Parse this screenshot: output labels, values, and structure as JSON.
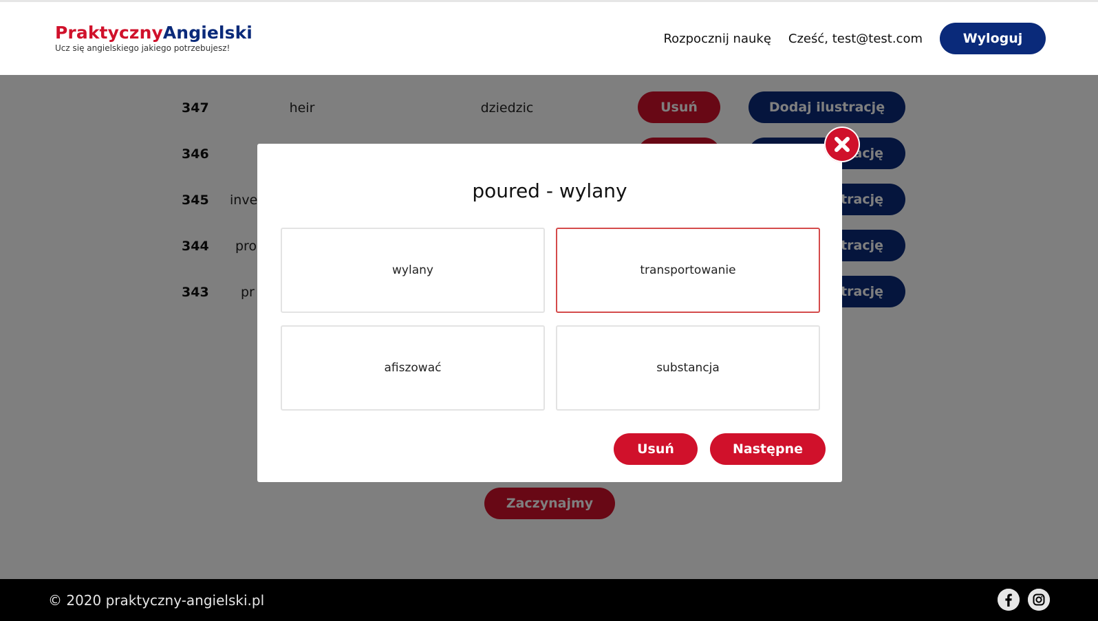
{
  "header": {
    "logo_part1": "Praktyczny",
    "logo_part2": "Angielski",
    "tagline": "Ucz się angielskiego jakiego potrzebujesz!",
    "nav_start": "Rozpocznij naukę",
    "greeting": "Cześć, test@test.com",
    "logout_label": "Wyloguj"
  },
  "rows": [
    {
      "num": "347",
      "en": "heir",
      "pl": "dziedzic",
      "delete_label": "Usuń",
      "illustration_label": "Dodaj ilustrację"
    },
    {
      "num": "346",
      "en": "",
      "pl": "",
      "delete_label": "",
      "illustration_label": "ację"
    },
    {
      "num": "345",
      "en": "inve",
      "pl": "",
      "delete_label": "",
      "illustration_label": "trację"
    },
    {
      "num": "344",
      "en": "pro",
      "pl": "",
      "delete_label": "",
      "illustration_label": "trację"
    },
    {
      "num": "343",
      "en": "pr",
      "pl": "",
      "delete_label": "",
      "illustration_label": "trację"
    }
  ],
  "start_label": "Zaczynajmy",
  "modal": {
    "title": "poured - wylany",
    "options": [
      "wylany",
      "transportowanie",
      "afiszować",
      "substancja"
    ],
    "selected_index": 1,
    "delete_label": "Usuń",
    "next_label": "Następne"
  },
  "footer": {
    "copyright": "© 2020 praktyczny-angielski.pl",
    "icons": [
      "facebook-icon",
      "instagram-icon"
    ]
  },
  "colors": {
    "brand_red": "#d0112b",
    "brand_blue": "#0a2a7a",
    "selected_border": "#d44a4a"
  }
}
